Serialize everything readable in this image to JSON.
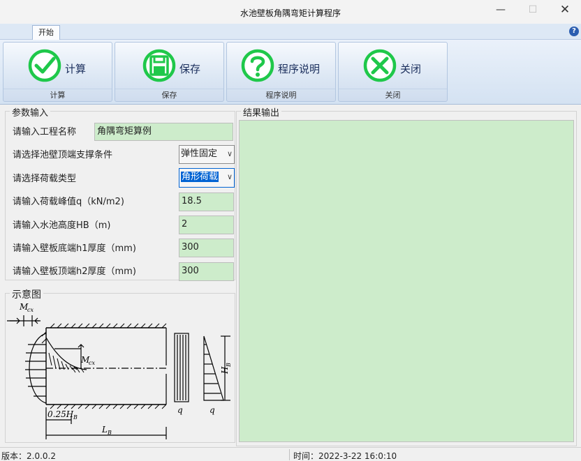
{
  "window": {
    "title": "水池壁板角隅弯矩计算程序",
    "min_glyph": "—",
    "max_glyph": "☐",
    "close_glyph": "✕"
  },
  "ribbon": {
    "tab": "开始",
    "help_glyph": "?",
    "groups": [
      {
        "button": "计算",
        "group": "计算",
        "icon": "check-circle-icon"
      },
      {
        "button": "保存",
        "group": "保存",
        "icon": "floppy-disk-icon"
      },
      {
        "button": "程序说明",
        "group": "程序说明",
        "icon": "question-circle-icon"
      },
      {
        "button": "关闭",
        "group": "关闭",
        "icon": "x-circle-icon"
      }
    ],
    "icon_color": "#1fc84a"
  },
  "params": {
    "legend": "参数输入",
    "rows": [
      {
        "label": "请输入工程名称",
        "value": "角隅弯矩算例"
      },
      {
        "label": "请选择池壁顶端支撑条件",
        "value": "弹性固定"
      },
      {
        "label": "请选择荷载类型",
        "value": "角形荷载"
      },
      {
        "label": "请输入荷载峰值q（kN/m2)",
        "value": "18.5"
      },
      {
        "label": "请输入水池高度HB（m)",
        "value": "2"
      },
      {
        "label": "请输入壁板底端h1厚度（mm)",
        "value": "300"
      },
      {
        "label": "请输入壁板顶端h2厚度（mm)",
        "value": "300"
      }
    ]
  },
  "diagram": {
    "legend": "示意图",
    "labels": {
      "mcx_top": "M",
      "mcx_sub": "cx",
      "mcx_mid": "M",
      "mcx_mid_sub": "cx",
      "hb": "H",
      "hb_sub": "B",
      "q1": "q",
      "q2": "q",
      "quarter": "0.25H",
      "quarter_sub": "B",
      "lb": "L",
      "lb_sub": "B"
    }
  },
  "results": {
    "legend": "结果输出",
    "bg": "#cdeccb"
  },
  "status": {
    "version": "版本：2.0.0.2",
    "time": "时间：2022-3-22  16:0:10"
  }
}
